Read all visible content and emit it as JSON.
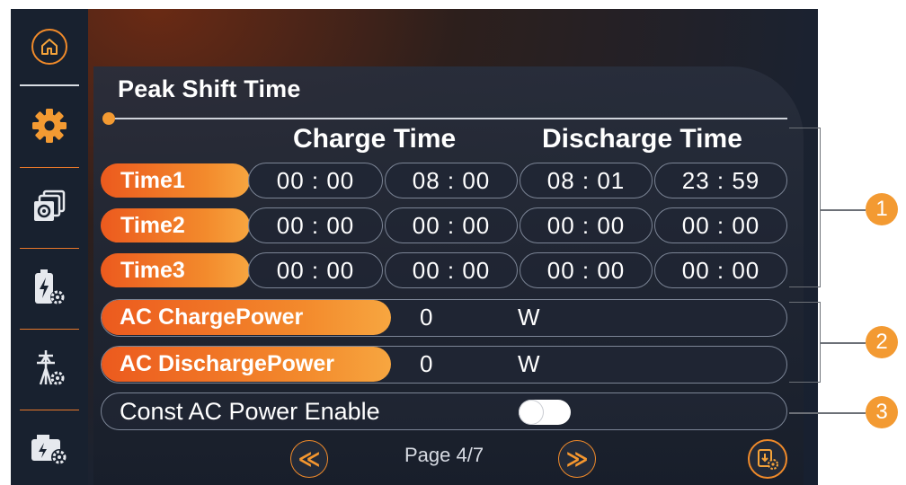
{
  "panel": {
    "title": "Peak Shift Time",
    "charge_header": "Charge Time",
    "discharge_header": "Discharge Time"
  },
  "time_rows": [
    {
      "label": "Time1",
      "charge_start": "00 : 00",
      "charge_end": "08 : 00",
      "discharge_start": "08 : 01",
      "discharge_end": "23 : 59"
    },
    {
      "label": "Time2",
      "charge_start": "00 : 00",
      "charge_end": "00 : 00",
      "discharge_start": "00 : 00",
      "discharge_end": "00 : 00"
    },
    {
      "label": "Time3",
      "charge_start": "00 : 00",
      "charge_end": "00 : 00",
      "discharge_start": "00 : 00",
      "discharge_end": "00 : 00"
    }
  ],
  "ac_charge": {
    "label": "AC ChargePower",
    "value": "0",
    "unit": "W"
  },
  "ac_discharge": {
    "label": "AC DischargePower",
    "value": "0",
    "unit": "W"
  },
  "const_ac": {
    "label": "Const AC Power Enable",
    "enabled": false
  },
  "pagination": {
    "page": "Page 4/7",
    "prev_glyph": "≪",
    "next_glyph": "≫"
  },
  "sidebar": [
    "home-icon",
    "gear-icon",
    "multi-settings-icon",
    "battery-settings-icon",
    "grid-settings-icon",
    "generator-settings-icon"
  ],
  "callouts": [
    "1",
    "2",
    "3"
  ],
  "colors": {
    "accent": "#f39a32",
    "accent_dark": "#ec5a1e",
    "background": "#1b2230"
  }
}
